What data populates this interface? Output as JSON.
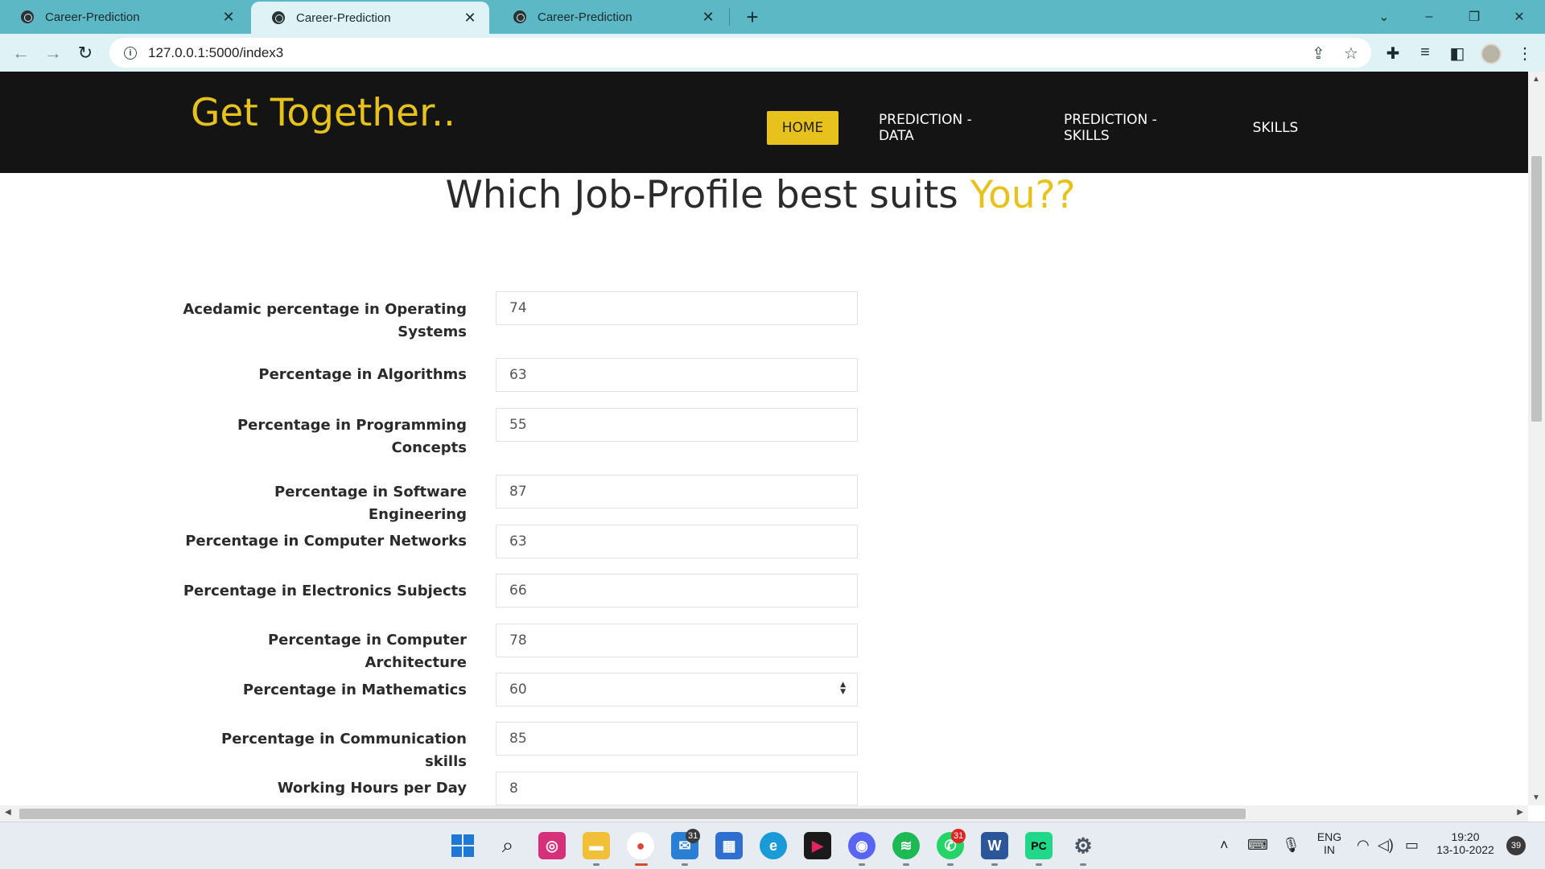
{
  "browser": {
    "tabs": [
      {
        "title": "Career-Prediction",
        "active": false
      },
      {
        "title": "Career-Prediction",
        "active": true
      },
      {
        "title": "Career-Prediction",
        "active": false
      }
    ],
    "url": "127.0.0.1:5000/index3"
  },
  "site": {
    "brand": "Get Together..",
    "nav": [
      "HOME",
      "PREDICTION - DATA",
      "PREDICTION - SKILLS",
      "SKILLS"
    ],
    "active_nav": "HOME",
    "accent_color": "#e8c21c",
    "headline": "Which Job-Profile best suits",
    "headline_accent": "You??"
  },
  "form": {
    "fields": [
      {
        "label": "Acedamic percentage in Operating Systems",
        "value": "74"
      },
      {
        "label": "Percentage in Algorithms",
        "value": "63"
      },
      {
        "label": "Percentage in Programming Concepts",
        "value": "55"
      },
      {
        "label": "Percentage in Software Engineering",
        "value": "87"
      },
      {
        "label": "Percentage in Computer Networks",
        "value": "63"
      },
      {
        "label": "Percentage in Electronics Subjects",
        "value": "66"
      },
      {
        "label": "Percentage in Computer Architecture",
        "value": "78"
      },
      {
        "label": "Percentage in Mathematics",
        "value": "60"
      },
      {
        "label": "Percentage in Communication skills",
        "value": "85"
      },
      {
        "label": "Working Hours per Day",
        "value": "8"
      }
    ]
  },
  "taskbar": {
    "mail_badge": "31",
    "whatsapp_badge": "31",
    "language": "ENG",
    "region": "IN",
    "time": "19:20",
    "date": "13-10-2022",
    "notifications": "39"
  }
}
